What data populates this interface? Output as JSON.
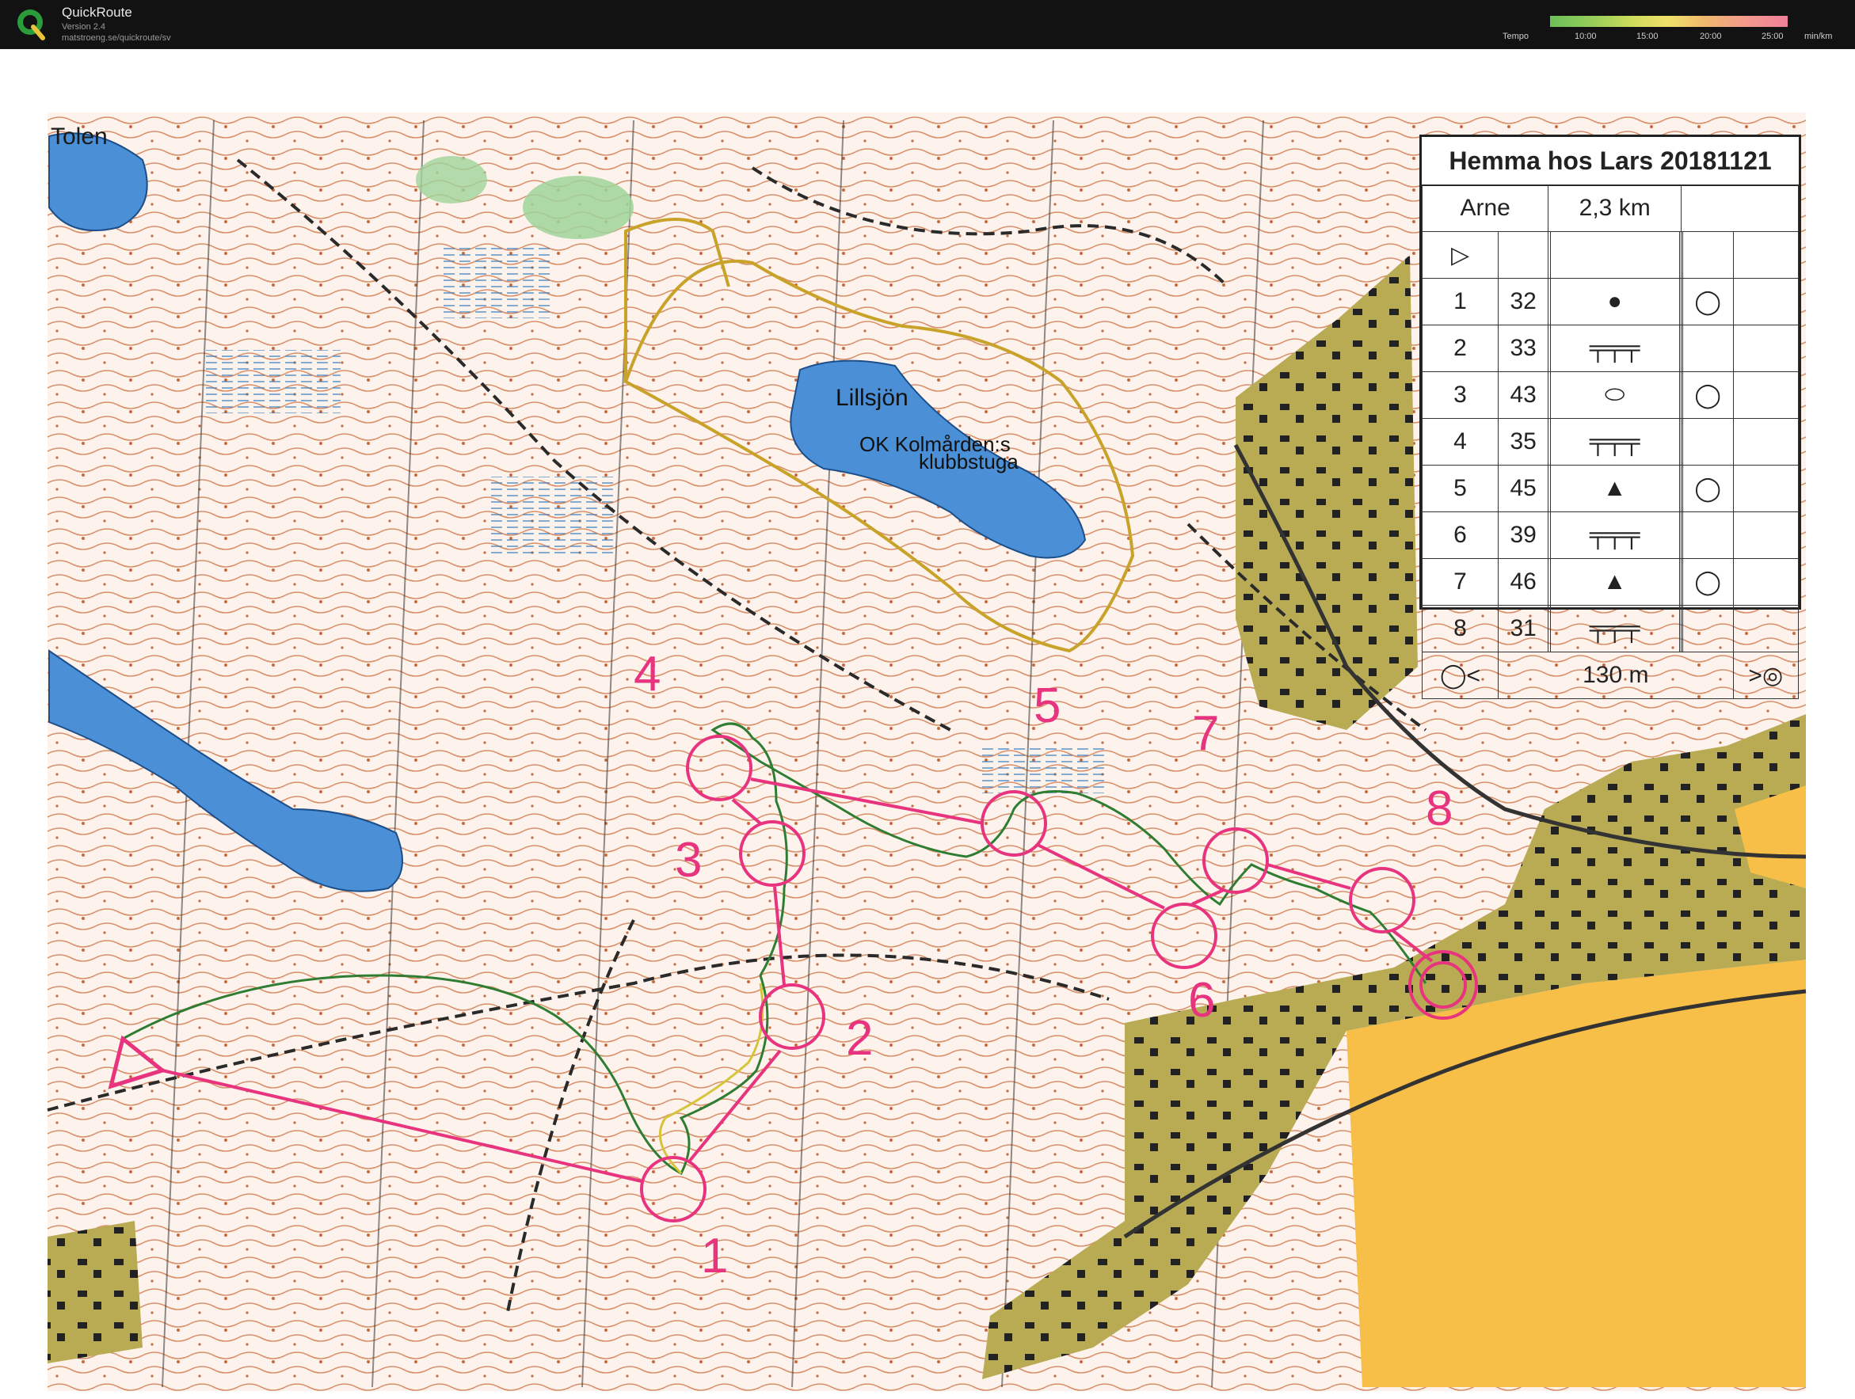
{
  "app": {
    "title": "QuickRoute",
    "version": "Version 2.4",
    "url": "matstroeng.se/quickroute/sv"
  },
  "tempo_scale": {
    "label": "Tempo",
    "ticks": [
      "10:00",
      "15:00",
      "20:00",
      "25:00"
    ],
    "unit": "min/km"
  },
  "map": {
    "labels": {
      "lake_tolen": "Tolen",
      "lake_lillsjon": "Lillsjön",
      "clubhouse_line1": "OK Kolmården:s",
      "clubhouse_line2": "klubbstuga"
    },
    "controls": [
      "1",
      "2",
      "3",
      "4",
      "5",
      "6",
      "7",
      "8"
    ]
  },
  "description_sheet": {
    "title": "Hemma hos Lars 20181121",
    "class_name": "Arne",
    "length": "2,3 km",
    "rows": [
      {
        "num": "1",
        "code": "32"
      },
      {
        "num": "2",
        "code": "33"
      },
      {
        "num": "3",
        "code": "43"
      },
      {
        "num": "4",
        "code": "35"
      },
      {
        "num": "5",
        "code": "45"
      },
      {
        "num": "6",
        "code": "39"
      },
      {
        "num": "7",
        "code": "46"
      },
      {
        "num": "8",
        "code": "31"
      }
    ],
    "finish_distance": "130 m"
  },
  "colors": {
    "course": "#e8337f",
    "route_green": "#2e7d32",
    "route_yellow": "#d6c43a",
    "contour": "#d07a4f",
    "water": "#4a90d9",
    "urban": "#b7a84f",
    "open_land": "#f8c046"
  }
}
